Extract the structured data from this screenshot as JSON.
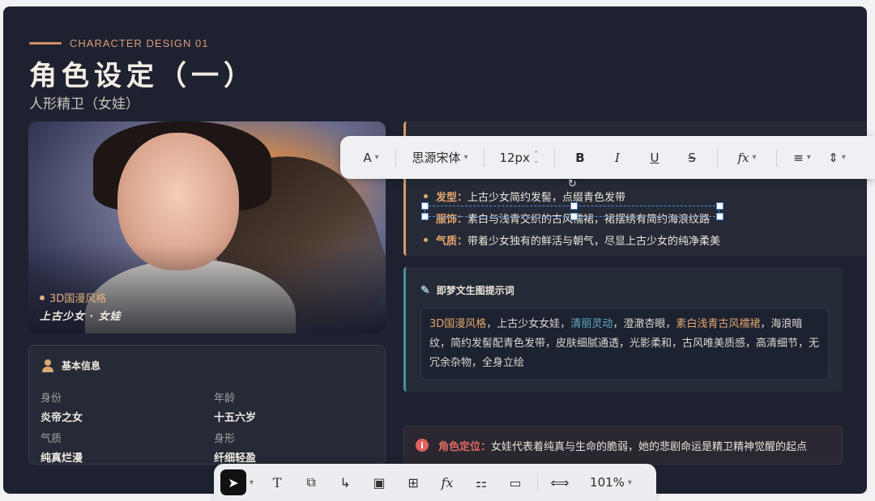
{
  "header": {
    "eyebrow": "CHARACTER DESIGN 01",
    "title": "角色设定（一）",
    "subtitle": "人形精卫（女娃）"
  },
  "portrait": {
    "tag": "3D国漫风格",
    "caption": "上古少女 · 女娃"
  },
  "info_card": {
    "heading": "基本信息",
    "fields": [
      {
        "key": "身份",
        "value": "炎帝之女"
      },
      {
        "key": "年龄",
        "value": "十五六岁"
      },
      {
        "key": "气质",
        "value": "纯真烂漫"
      },
      {
        "key": "身形",
        "value": "纤细轻盈"
      }
    ]
  },
  "traits": [
    {
      "key": "发型：",
      "value": "上古少女简约发髻，点缀青色发带"
    },
    {
      "key": "服饰：",
      "value": "素白与浅青交织的古风襦裙，裙摆绣有简约海浪纹路"
    },
    {
      "key": "气质：",
      "value": "带着少女独有的鲜活与朝气，尽显上古少女的纯净柔美"
    }
  ],
  "prompt": {
    "heading": "即梦文生图提示词",
    "segments": {
      "s1": "3D国漫风格",
      "s2": "，上古少女女娃，",
      "s3": "清丽灵动",
      "s4": "，澄澈杏眼，",
      "s5": "素白浅青古风襦裙",
      "s6": "，海浪暗纹，简约发髻配青色发带，皮肤细腻通透，光影柔和，古风唯美质感，高清细节，无冗余杂物，全身立绘"
    }
  },
  "role": {
    "icon": "info-icon",
    "key": "角色定位：",
    "value": "女娃代表着纯真与生命的脆弱，她的悲剧命运是精卫精神觉醒的起点"
  },
  "format_toolbar": {
    "font_icon": "A",
    "font_family": "思源宋体",
    "font_size": "12px",
    "bold": "B",
    "italic": "I",
    "underline": "U",
    "strike": "S",
    "formula": "fx"
  },
  "bottom_toolbar": {
    "zoom": "101%",
    "text_tool": "T",
    "formula_tool": "fx"
  },
  "colors": {
    "accent_gold": "#e3a66f",
    "accent_teal": "#5fb0c8",
    "accent_red": "#e26a63",
    "background": "#1e2230"
  }
}
